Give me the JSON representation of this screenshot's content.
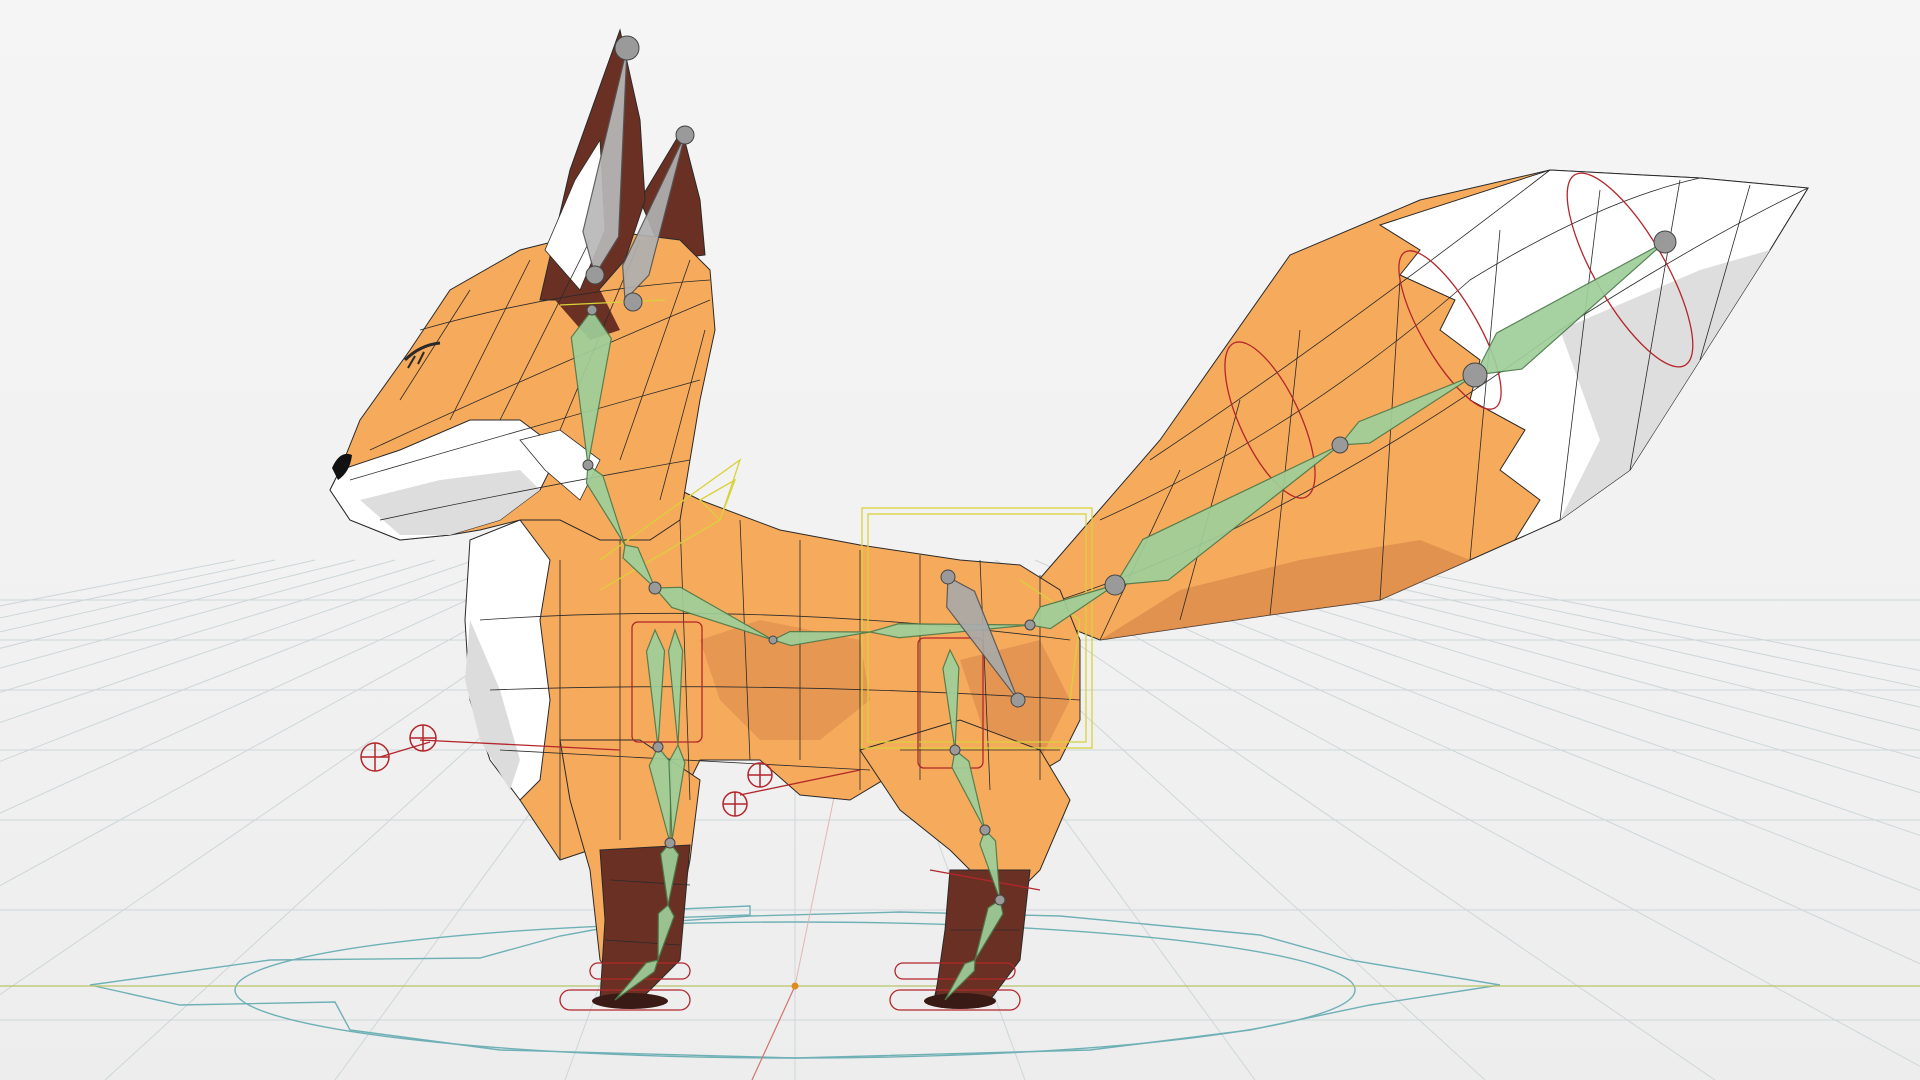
{
  "viewport": {
    "mode": "3d-rig-viewport",
    "background_color": "#f2f2f2",
    "grid_color": "#c9d3d6",
    "grid_shown": true
  },
  "model": {
    "subject": "low-poly fox",
    "fur_color": "#f6aa5c",
    "fur_shade_color": "#d9874a",
    "white_fur_color": "#ffffff",
    "dark_fur_color": "#6a3024",
    "wireframe_color": "#2a2a2a"
  },
  "rig": {
    "bone_color": "#9fcf9a",
    "bone_outline_color": "#4c7a4b",
    "joint_color": "#9a9a9a",
    "controller_red": "#b3262b",
    "controller_yellow": "#d9d23a",
    "ground_circle_color": "#6fb0b6",
    "axis_x_color": "#b9c46a",
    "axis_y_color": "#d27272",
    "origin_marker_color": "#e08a20"
  }
}
